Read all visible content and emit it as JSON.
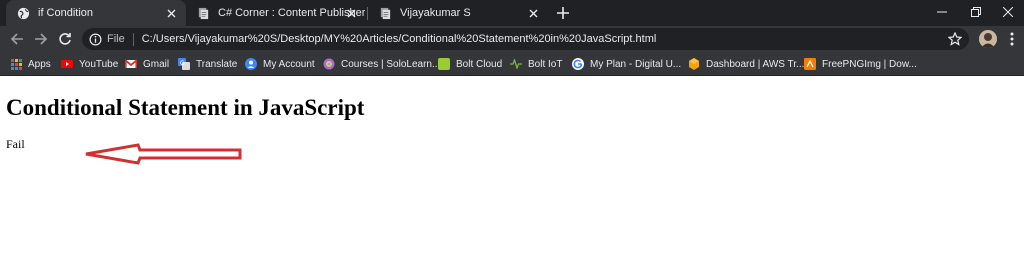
{
  "browser": {
    "tabs": [
      {
        "title": "if Condition",
        "active": true,
        "icon": "globe-icon"
      },
      {
        "title": "C# Corner : Content Publisher",
        "active": false,
        "icon": "page-icon"
      },
      {
        "title": "Vijayakumar S",
        "active": false,
        "icon": "page-icon"
      }
    ],
    "new_tab_icon": "plus-icon",
    "window_controls": [
      "minimize-icon",
      "restore-icon",
      "close-icon"
    ]
  },
  "toolbar": {
    "nav_icons": [
      "back-arrow-icon",
      "forward-arrow-icon",
      "reload-icon"
    ],
    "omnibox": {
      "scheme_label": "File",
      "url": "C:/Users/Vijayakumar%20S/Desktop/MY%20Articles/Conditional%20Statement%20in%20JavaScript.html"
    },
    "star_icon": "bookmark-star-icon",
    "profile_icon": "profile-avatar",
    "menu_icon": "kebab-menu-icon"
  },
  "bookmarks": [
    {
      "label": "Apps",
      "icon": "apps-grid-icon",
      "color": "#ea4335"
    },
    {
      "label": "YouTube",
      "icon": "youtube-icon",
      "color": "#ff0000"
    },
    {
      "label": "Gmail",
      "icon": "gmail-icon",
      "color": "#d93025"
    },
    {
      "label": "Translate",
      "icon": "translate-icon",
      "color": "#4285f4"
    },
    {
      "label": "My Account",
      "icon": "google-account-icon",
      "color": "#4285f4"
    },
    {
      "label": "Courses | SoloLearn...",
      "icon": "sololearn-icon",
      "color": "#a56ad8"
    },
    {
      "label": "Bolt Cloud",
      "icon": "bolt-cloud-icon",
      "color": "#9acd32"
    },
    {
      "label": "Bolt IoT",
      "icon": "bolt-iot-icon",
      "color": "#7cb342"
    },
    {
      "label": "My Plan - Digital U...",
      "icon": "google-g-icon",
      "color": "#4285f4"
    },
    {
      "label": "Dashboard | AWS Tr...",
      "icon": "aws-icon",
      "color": "#f0a30a"
    },
    {
      "label": "FreePNGImg | Dow...",
      "icon": "freepng-icon",
      "color": "#f57c00"
    }
  ],
  "page": {
    "heading": "Conditional Statement in JavaScript",
    "output_text": "Fail",
    "annotation": {
      "shape": "left-pointing-arrow",
      "color": "#d32f2f"
    }
  }
}
